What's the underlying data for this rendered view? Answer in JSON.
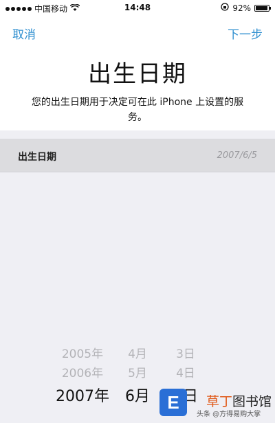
{
  "status_bar": {
    "carrier": "中国移动",
    "time": "14:48",
    "battery": "92%",
    "battery_level": 0.92
  },
  "nav": {
    "cancel": "取消",
    "next": "下一步"
  },
  "title": "出生日期",
  "description": "您的出生日期用于决定可在此 iPhone 上设置的服务。",
  "birth_row": {
    "label": "出生日期",
    "value": "2007/6/5"
  },
  "picker": {
    "years": [
      "2005年",
      "2006年",
      "2007年"
    ],
    "months": [
      "4月",
      "5月",
      "6月"
    ],
    "days": [
      "3日",
      "4日",
      "5日"
    ]
  },
  "watermark": {
    "logo": "E",
    "text_highlight": "草丁",
    "text_rest": "图书馆",
    "author": "头条 @方得易购大掌"
  },
  "colors": {
    "accent": "#2f8fd0",
    "background_gray": "#efeff4",
    "row_gray": "#dcdcdf"
  }
}
